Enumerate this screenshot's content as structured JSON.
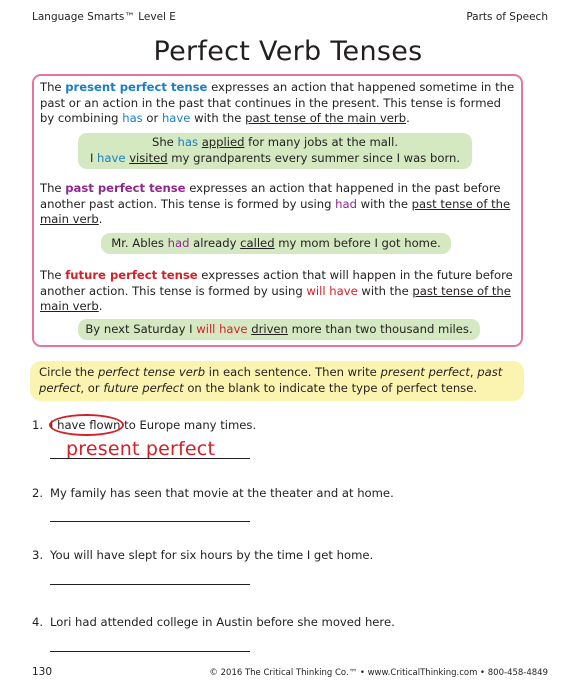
{
  "header": {
    "left": "Language Smarts™ Level E",
    "right": "Parts of Speech"
  },
  "title": "Perfect Verb Tenses",
  "present": {
    "p1": "The ",
    "term": "present perfect tense",
    "p2": " expresses an action that happened sometime in the",
    "line2": "past or an action in the past that continues in the present.  This tense is formed",
    "p3": "by combining ",
    "has": "has",
    "or": " or ",
    "have": "have",
    "with": " with the ",
    "ptmv": "past tense of the main verb",
    "end": ".",
    "ex1_a": "She ",
    "ex1_has": "has",
    "ex1_sp": " ",
    "ex1_verb": "applied",
    "ex1_b": " for many jobs at the mall.",
    "ex2_a": "I ",
    "ex2_have": "have",
    "ex2_sp": " ",
    "ex2_verb": "visited",
    "ex2_b": " my grandparents every summer since I was born."
  },
  "past": {
    "p1": "The ",
    "term": "past perfect tense",
    "p2": " expresses an action that happened in the past before",
    "p3": "another past action.  This tense is formed by using ",
    "had": "had",
    "with": " with the ",
    "ptmv1": "past tense of the",
    "ptmv2": "main verb",
    "end": ".",
    "ex_a": "Mr. Ables ",
    "ex_had": "had",
    "ex_b": " already ",
    "ex_verb": "called",
    "ex_c": " my mom before I got home."
  },
  "future": {
    "p1": "The ",
    "term": "future perfect tense",
    "p2": " expresses action that will happen in the future before",
    "p3": "another action.  This tense is formed by using ",
    "will_have": "will have",
    "with": " with the ",
    "ptmv1": "past tense of the",
    "ptmv2": "main verb",
    "end": ".",
    "ex_a": "By next Saturday I ",
    "ex_wh": "will have",
    "ex_sp": " ",
    "ex_verb": "driven",
    "ex_b": " more than two thousand miles."
  },
  "instructions": {
    "a": "Circle the ",
    "b": "perfect tense verb",
    "c": " in each sentence.  Then write ",
    "d": "present perfect",
    "e": ", ",
    "f": "past",
    "g": "perfect",
    "h": ", or ",
    "i": "future perfect",
    "j": " on the blank to indicate the type of perfect tense."
  },
  "items": [
    {
      "num": "1.",
      "pre": "I ",
      "circled": "have flown",
      "post": " to Europe many times.",
      "answer": "present perfect"
    },
    {
      "num": "2.",
      "text": "My family has seen that movie at the theater and at home."
    },
    {
      "num": "3.",
      "text": "You will have slept for six hours by the time I get home."
    },
    {
      "num": "4.",
      "text": "Lori had attended college in Austin before she moved here."
    }
  ],
  "footer": {
    "page": "130",
    "copyright": "© 2016 The Critical Thinking Co.™ • www.CriticalThinking.com • 800-458-4849"
  }
}
